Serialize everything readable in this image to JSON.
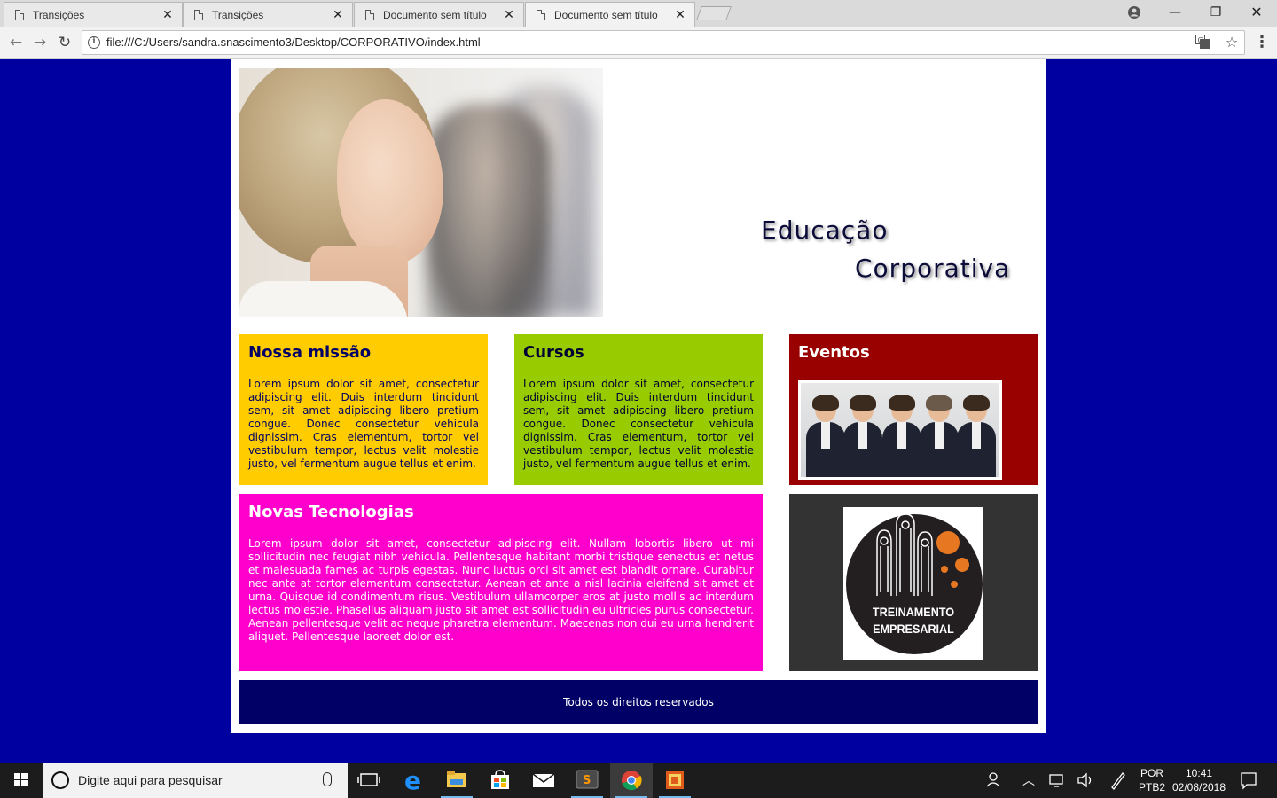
{
  "browser": {
    "tabs": [
      {
        "label": "Transições"
      },
      {
        "label": "Transições"
      },
      {
        "label": "Documento sem título"
      },
      {
        "label": "Documento sem título"
      }
    ],
    "url": "file:///C:/Users/sandra.snascimento3/Desktop/CORPORATIVO/index.html"
  },
  "page": {
    "brand_line1": "Educação",
    "brand_line2": "Corporativa",
    "missao": {
      "title": "Nossa missão",
      "text": "Lorem ipsum dolor sit amet, consectetur adipiscing elit. Duis interdum tincidunt sem, sit amet adipiscing libero pretium congue. Donec consectetur vehicula dignissim. Cras elementum, tortor vel vestibulum tempor, lectus velit molestie justo, vel fermentum augue tellus et enim."
    },
    "cursos": {
      "title": "Cursos",
      "text": "Lorem ipsum dolor sit amet, consectetur adipiscing elit. Duis interdum tincidunt sem, sit amet adipiscing libero pretium congue. Donec consectetur vehicula dignissim. Cras elementum, tortor vel vestibulum tempor, lectus velit molestie justo, vel fermentum augue tellus et enim."
    },
    "eventos": {
      "title": "Eventos"
    },
    "tecnologias": {
      "title": "Novas Tecnologias",
      "text": "Lorem ipsum dolor sit amet, consectetur adipiscing elit. Nullam lobortis libero ut mi sollicitudin nec feugiat nibh vehicula. Pellentesque habitant morbi tristique senectus et netus et malesuada fames ac turpis egestas. Nunc luctus orci sit amet est blandit ornare. Curabitur nec ante at tortor elementum consectetur. Aenean et ante a nisl lacinia eleifend sit amet et urna. Quisque id condimentum risus. Vestibulum ullamcorper eros at justo mollis ac interdum lectus molestie. Phasellus aliquam justo sit amet est sollicitudin eu ultricies purus consectetur. Aenean pellentesque velit ac neque pharetra elementum. Maecenas non dui eu urna hendrerit aliquet. Pellentesque laoreet dolor est."
    },
    "logo": {
      "line1": "TREINAMENTO",
      "line2": "EMPRESARIAL"
    },
    "footer": "Todos os direitos reservados"
  },
  "taskbar": {
    "search_placeholder": "Digite aqui para pesquisar",
    "lang_top": "POR",
    "lang_bottom": "PTB2",
    "time": "10:41",
    "date": "02/08/2018"
  },
  "colors": {
    "background": "#0000a0",
    "missao": "#ffcc00",
    "cursos": "#99cc00",
    "eventos": "#990000",
    "tecnologias": "#ff00cc",
    "treinamento": "#333333",
    "footer": "#000066"
  }
}
